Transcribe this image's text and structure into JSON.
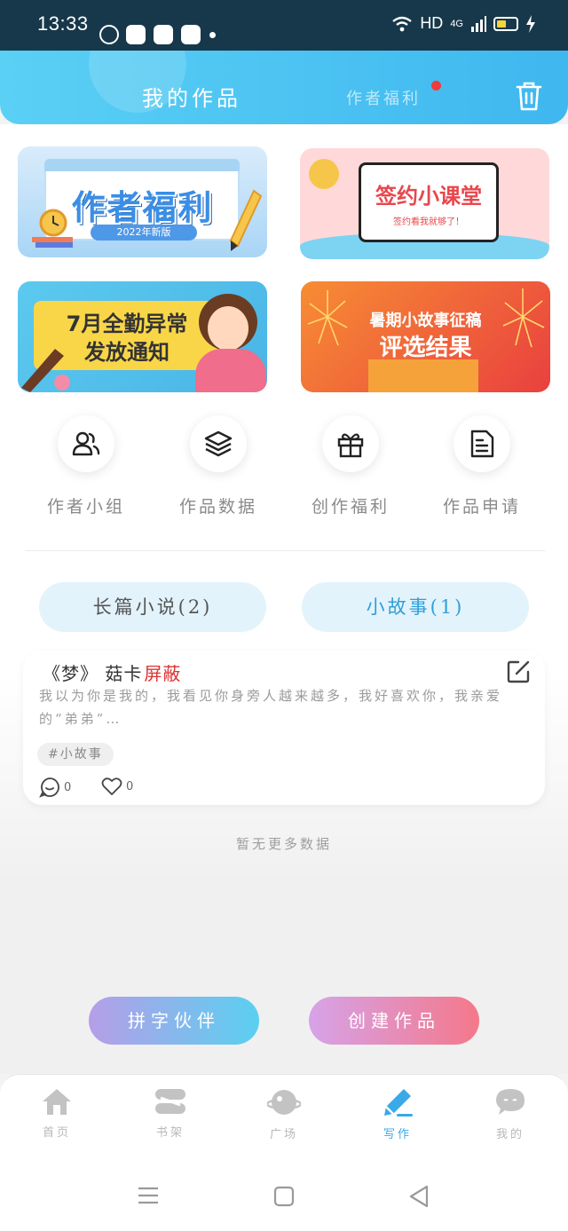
{
  "status_bar": {
    "time": "13:33",
    "network": "HD",
    "signal": "4G"
  },
  "header": {
    "tab_active": "我的作品",
    "tab_other": "作者福利",
    "accent": "#3fb7ef"
  },
  "banners": [
    {
      "title": "作者福利",
      "subtitle": "2022年新版"
    },
    {
      "title": "签约小课堂",
      "subtitle": "签约看我就够了！"
    },
    {
      "line1": "7月全勤异常",
      "line2": "发放通知"
    },
    {
      "line1": "暑期小故事征稿",
      "line2": "评选结果"
    }
  ],
  "quick_actions": [
    {
      "label": "作者小组",
      "icon": "users-icon"
    },
    {
      "label": "作品数据",
      "icon": "layers-icon"
    },
    {
      "label": "创作福利",
      "icon": "gift-icon"
    },
    {
      "label": "作品申请",
      "icon": "document-icon"
    }
  ],
  "segments": {
    "novel": "长篇小说(2)",
    "story": "小故事(1)"
  },
  "story_card": {
    "title": "《梦》 菇卡",
    "status": "屏蔽",
    "excerpt": "我以为你是我的，我看见你身旁人越来越多，我好喜欢你，我亲爱的“弟弟”…",
    "tag": "#小故事",
    "comments": "0",
    "likes": "0"
  },
  "empty_text": "暂无更多数据",
  "buttons": {
    "partner": "拼字伙伴",
    "create": "创建作品"
  },
  "bottom_nav": [
    {
      "label": "首页",
      "icon": "home-icon"
    },
    {
      "label": "书架",
      "icon": "bookshelf-icon"
    },
    {
      "label": "广场",
      "icon": "planet-icon"
    },
    {
      "label": "写作",
      "icon": "pen-icon",
      "active": true
    },
    {
      "label": "我的",
      "icon": "chat-face-icon"
    }
  ]
}
